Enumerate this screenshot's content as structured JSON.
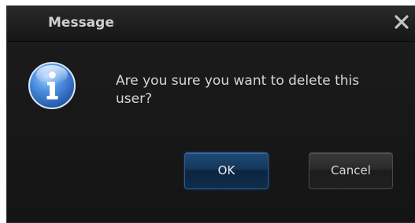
{
  "dialog": {
    "title": "Message",
    "close_icon": "close-icon",
    "icon": "info-icon",
    "message": "Are you sure you want to delete this user?",
    "buttons": {
      "ok_label": "OK",
      "cancel_label": "Cancel"
    }
  },
  "colors": {
    "dialog_background": "#151515",
    "title_text": "#d0d0d0",
    "message_text": "#d6d6d6",
    "ok_button": "#153758",
    "cancel_button": "#2a2a2a",
    "info_icon_blue": "#3d7fd0"
  }
}
